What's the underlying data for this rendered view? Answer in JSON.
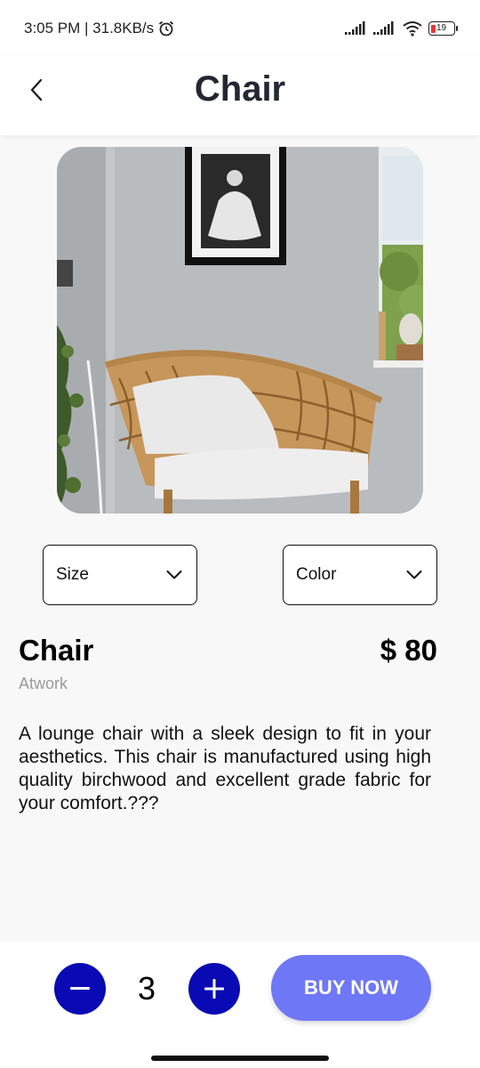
{
  "status_bar": {
    "time_speed": "3:05 PM | 31.8KB/s",
    "battery": "19",
    "icons": [
      "alarm-icon",
      "signal-icon",
      "wifi-icon",
      "battery-icon"
    ]
  },
  "header": {
    "title": "Chair",
    "back_icon": "chevron-left-icon"
  },
  "product": {
    "image_alt": "Rattan lounge chair",
    "name": "Chair",
    "price": "$ 80",
    "brand": "Atwork",
    "description": "A lounge chair with a sleek design to fit in your aesthetics. This chair is manufactured using high quality birchwood and excellent grade fabric for your comfort.???"
  },
  "options": {
    "size_label": "Size",
    "color_label": "Color"
  },
  "cart": {
    "quantity": "3",
    "buy_label": "BUY NOW"
  },
  "colors": {
    "qty_button": "#0a0ab4",
    "buy_button": "#6e78f7",
    "title": "#232733"
  }
}
